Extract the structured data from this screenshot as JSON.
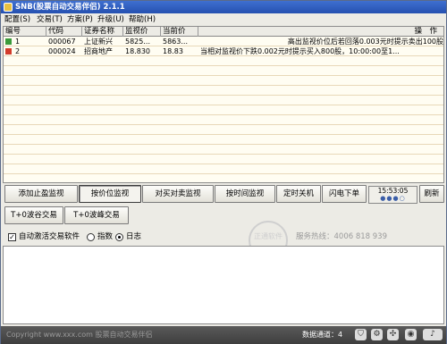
{
  "window": {
    "title": "SNB(股票自动交易伴侣) 2.1.1"
  },
  "menu": [
    {
      "label": "配置(S)"
    },
    {
      "label": "交易(T)"
    },
    {
      "label": "方案(P)"
    },
    {
      "label": "升级(U)"
    },
    {
      "label": "帮助(H)"
    }
  ],
  "table": {
    "headers": [
      "编号",
      "代码",
      "证券名称",
      "监视价",
      "当前价",
      "操　作"
    ],
    "rows": [
      {
        "num": "1",
        "code": "000067",
        "name": "上证新兴",
        "watch_price": "5825...",
        "current_price": "5863...",
        "operation": "高出监视价位后若回落0.003元时提示卖出100股",
        "status_color": "#3a9a3a"
      },
      {
        "num": "2",
        "code": "000024",
        "name": "招商地产",
        "watch_price": "18.830",
        "current_price": "18.83",
        "operation": "当相对监视价下跌0.002元时提示买入800股，10:00:00至1...",
        "status_color": "#d23b2a"
      }
    ]
  },
  "buttons": {
    "add_take_profit": "添加止盈监视",
    "hold_monitor": "按价位监视",
    "pair_trade": "对买对卖监视",
    "time_monitor": "按时间监视",
    "timed_shutdown": "定时关机",
    "flash_order": "闪电下单",
    "refresh": "刷新",
    "t0_band": "T+0波谷交易",
    "t0_peak": "T+0波峰交易"
  },
  "clock": {
    "time": "15:53:05",
    "dots": "●●●○"
  },
  "options": {
    "auto_activate": "自动激活交易软件",
    "auto_checked": "✓",
    "opt_index": "指数",
    "opt_log": "日志",
    "hotline": "服务热线：4006 818 939"
  },
  "watermark": {
    "text": "正通软件"
  },
  "status": {
    "copyright": "Copyright www.xxx.com 股票自动交易伴侣",
    "channel": "数据通道：4"
  }
}
